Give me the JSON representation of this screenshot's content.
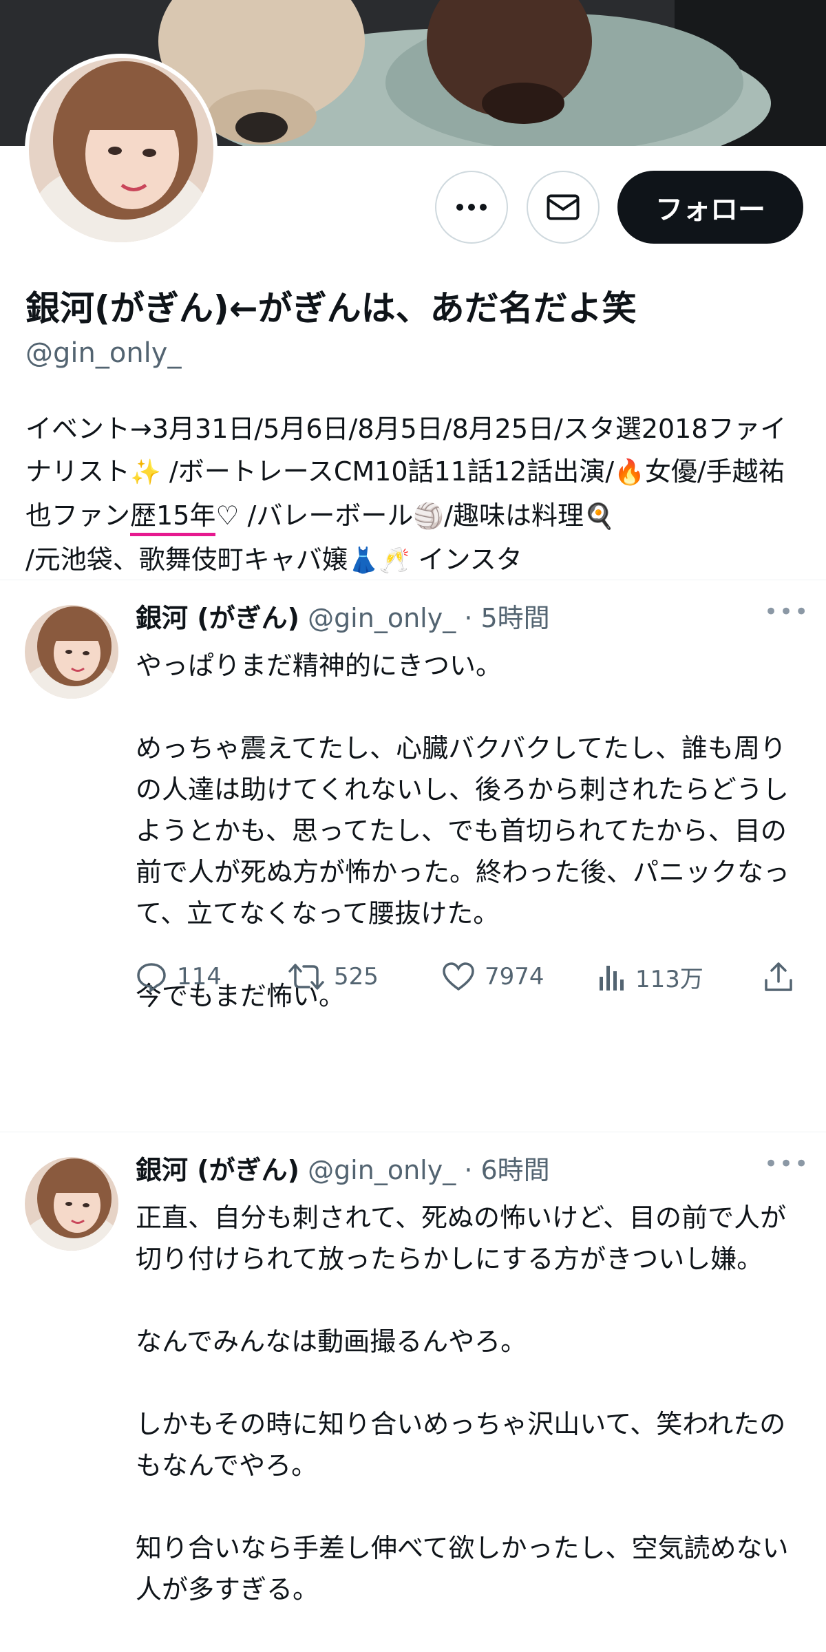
{
  "profile": {
    "display_name": "銀河(がぎん)←がぎんは、あだ名だよ笑",
    "handle": "@gin_only_",
    "follow_label": "フォロー",
    "bio": {
      "part1": "イベント→3月31日/5月6日/8月5日/8月25日/スタ選2018ファイナリスト",
      "emoji_sparkles": "✨",
      "part2": " /ボートレースCM10話11話12話出演/",
      "emoji_fire": "🔥",
      "part3": "女優/手越祐也ファン",
      "highlight": "歴15年",
      "part4": "♡ /バレーボール",
      "emoji_volleyball": "🏐",
      "part5": "/趣味は料理",
      "emoji_pan": "🍳",
      "part6": "/元池袋、歌舞伎町キャバ嬢",
      "emoji_dress": "👗",
      "emoji_glasses": "🥂",
      "part7": " インスタ"
    }
  },
  "icons": {
    "more": "more-dots-icon",
    "mail": "mail-icon",
    "reply": "reply-icon",
    "retweet": "retweet-icon",
    "like": "heart-icon",
    "views": "views-bar-chart-icon",
    "share": "share-icon"
  },
  "tweets": [
    {
      "name": "銀河 (がぎん)",
      "handle": "@gin_only_",
      "time": "· 5時間",
      "more": "•••",
      "lines": [
        "やっぱりまだ精神的にきつい。",
        "",
        "めっちゃ震えてたし、心臓バクバクしてたし、誰も周りの人達は助けてくれないし、後ろから刺されたらどうしようとかも、思ってたし、でも首切られてたから、目の前で人が死ぬ方が怖かった。終わった後、パニックなって、立てなくなって腰抜けた。",
        "",
        "今でもまだ怖い。"
      ],
      "stats": {
        "replies": "114",
        "retweets": "525",
        "likes": "7974",
        "views": "113万"
      }
    },
    {
      "name": "銀河 (がぎん)",
      "handle": "@gin_only_",
      "time": "· 6時間",
      "more": "•••",
      "lines": [
        "正直、自分も刺されて、死ぬの怖いけど、目の前で人が切り付けられて放ったらかしにする方がきついし嫌。",
        "",
        "なんでみんなは動画撮るんやろ。",
        "",
        "しかもその時に知り合いめっちゃ沢山いて、笑われたのもなんでやろ。",
        "",
        "知り合いなら手差し伸べて欲しかったし、空気読めない人が多すぎる。"
      ]
    }
  ],
  "colors": {
    "text": "#0f1419",
    "secondary": "#536471",
    "border": "#cfd9de",
    "highlight_underline": "#e6198f",
    "follow_bg": "#0f1419"
  }
}
